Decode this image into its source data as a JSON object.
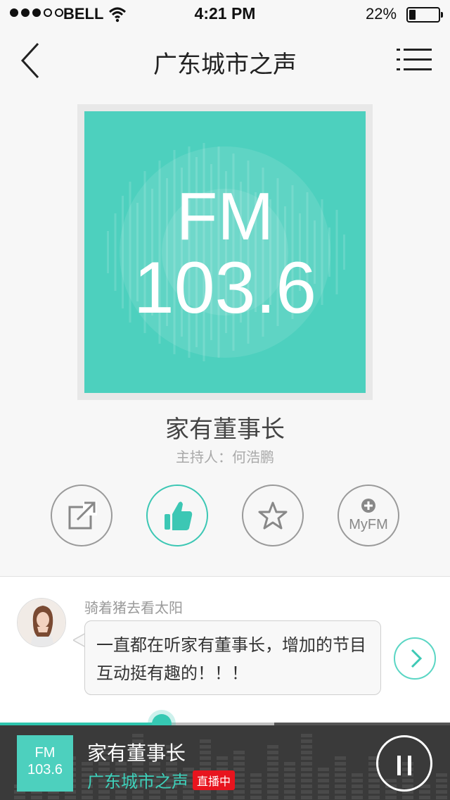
{
  "status_bar": {
    "carrier": "BELL",
    "time": "4:21 PM",
    "battery_percent": "22%",
    "battery_level": 0.22,
    "signal_bars_filled": 3,
    "signal_bars_total": 5
  },
  "nav": {
    "title": "广东城市之声",
    "back_icon": "chevron-left-icon",
    "menu_icon": "menu-list-icon"
  },
  "station": {
    "band": "FM",
    "frequency": "103.6"
  },
  "program": {
    "title": "家有董事长",
    "host": "主持人：何浩鹏"
  },
  "actions": {
    "share_icon": "share-icon",
    "like_icon": "thumbs-up-icon",
    "favorite_icon": "star-icon",
    "myfm_label": "MyFM"
  },
  "comment": {
    "username": "骑着猪去看太阳",
    "text": "一直都在听家有董事长，增加的节目互动挺有趣的！！！"
  },
  "playback": {
    "progress": 0.36,
    "buffered": 0.61
  },
  "player": {
    "band": "FM",
    "frequency": "103.6",
    "title": "家有董事长",
    "station": "广东城市之声",
    "live_badge": "直播中",
    "pause_icon": "pause-icon"
  },
  "colors": {
    "accent": "#4dd0be",
    "live_red": "#e8141e",
    "player_bg": "#3a3a3a"
  }
}
